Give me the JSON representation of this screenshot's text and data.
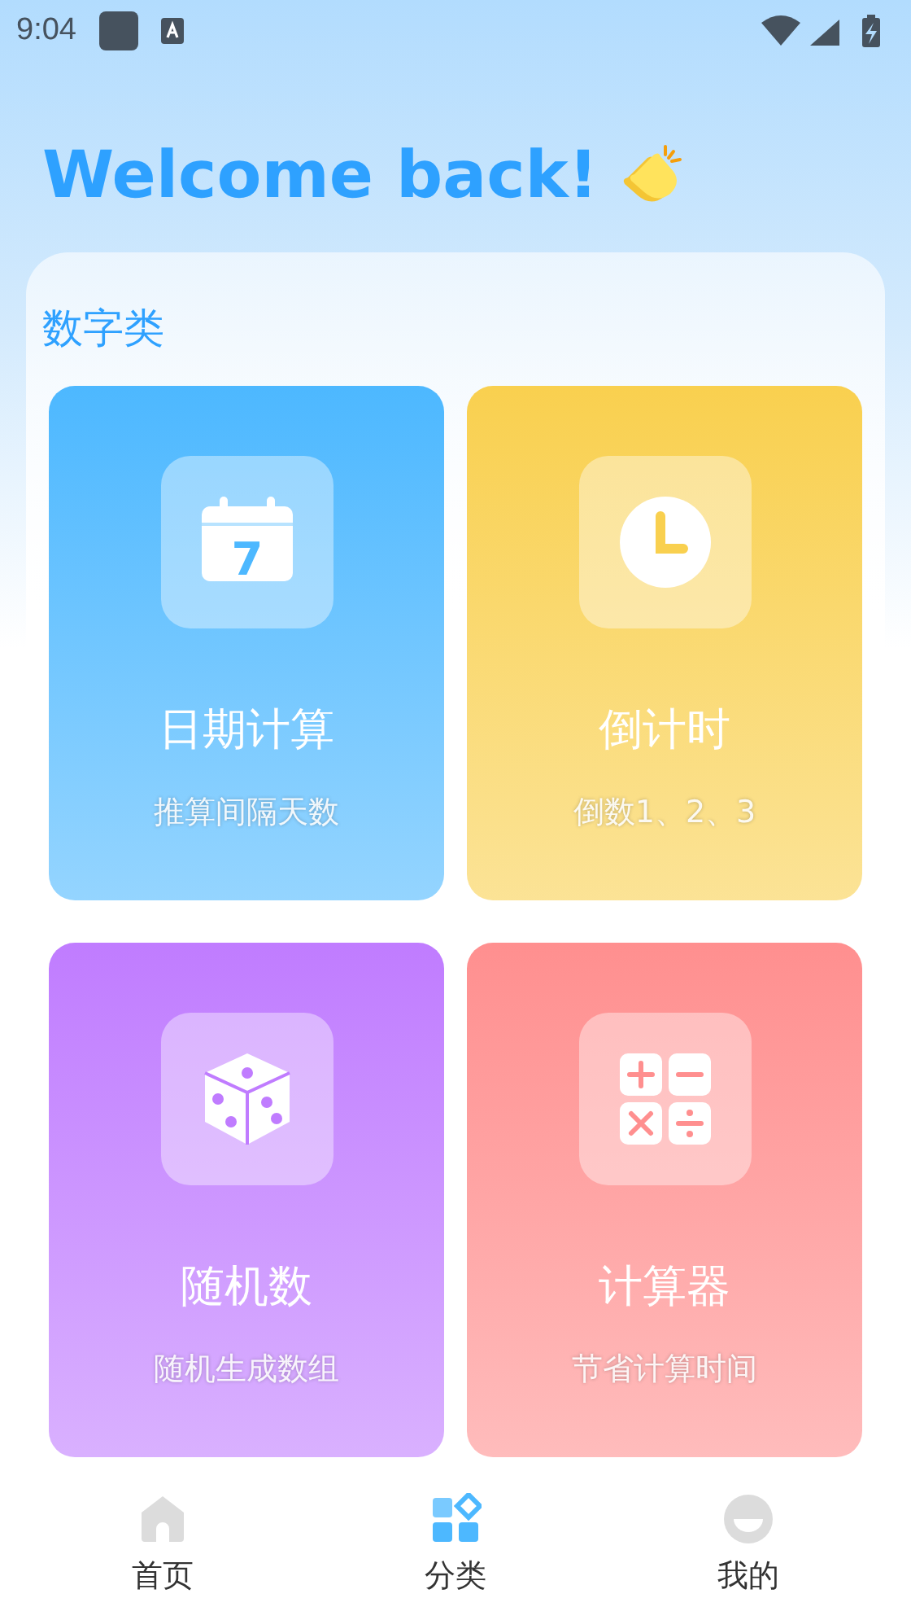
{
  "status_bar": {
    "time": "9:04"
  },
  "greeting": {
    "title": "Welcome back!"
  },
  "section": {
    "title": "数字类",
    "cards": [
      {
        "kind": "calendar",
        "icon_text": "7",
        "title": "日期计算",
        "subtitle": "推算间隔天数",
        "color": "#4db8ff"
      },
      {
        "kind": "clock",
        "title": "倒计时",
        "subtitle": "倒数1、2、3",
        "color": "#f9d04f"
      },
      {
        "kind": "dice",
        "title": "随机数",
        "subtitle": "随机生成数组",
        "color": "#c07cff"
      },
      {
        "kind": "calculator",
        "title": "计算器",
        "subtitle": "节省计算时间",
        "color": "#ff8f8f"
      }
    ]
  },
  "bottom_nav": [
    {
      "kind": "home",
      "label": "首页",
      "selected": false
    },
    {
      "kind": "category",
      "label": "分类",
      "selected": true
    },
    {
      "kind": "profile",
      "label": "我的",
      "selected": false
    }
  ]
}
